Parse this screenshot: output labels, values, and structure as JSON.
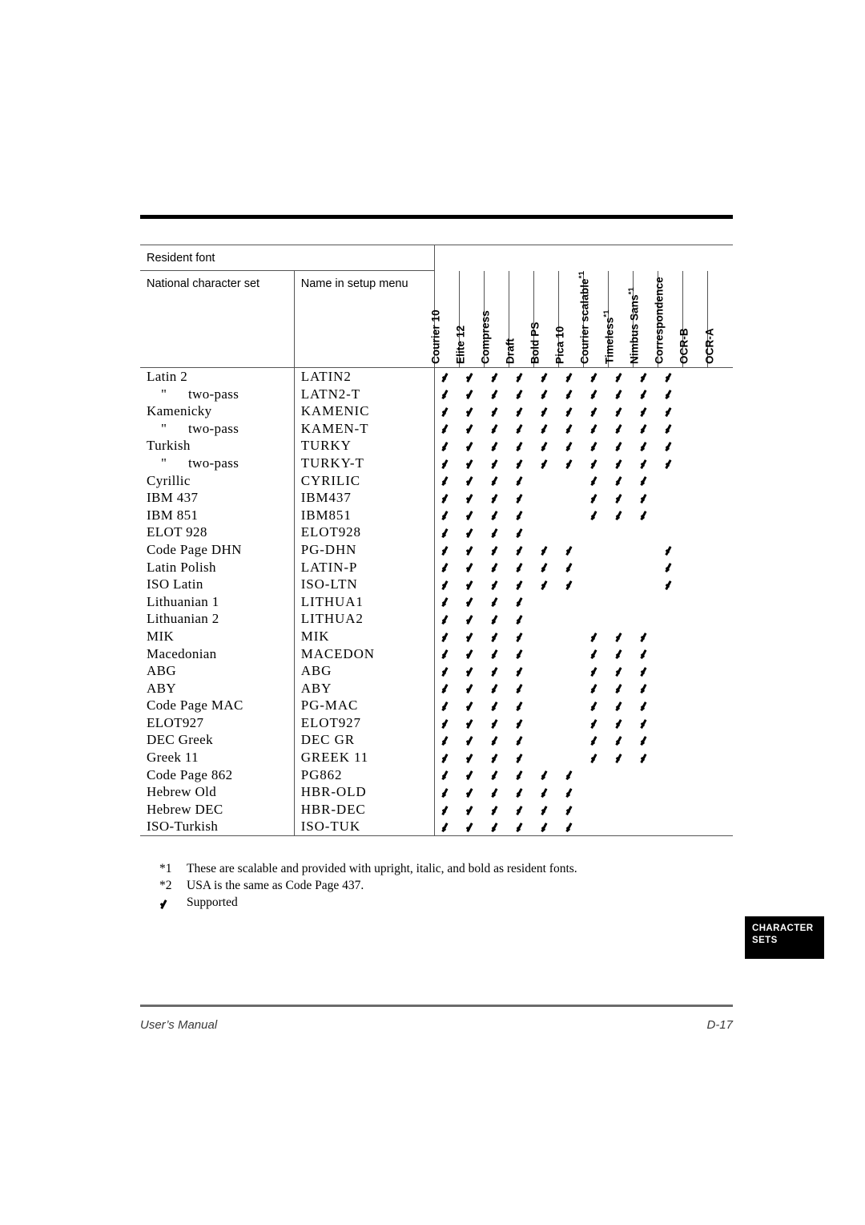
{
  "table": {
    "header": {
      "resident_font": "Resident font",
      "national_character_set": "National character set",
      "name_in_setup_menu": "Name in setup menu",
      "columns": [
        {
          "label": "Courier 10",
          "note": ""
        },
        {
          "label": "Elite 12",
          "note": ""
        },
        {
          "label": "Compress",
          "note": ""
        },
        {
          "label": "Draft",
          "note": ""
        },
        {
          "label": "Bold PS",
          "note": ""
        },
        {
          "label": "Pica 10",
          "note": ""
        },
        {
          "label": "Courier scalable",
          "note": "*1"
        },
        {
          "label": "Timeless",
          "note": "*1"
        },
        {
          "label": "Nimbus Sans",
          "note": "*1"
        },
        {
          "label": "Correspondence",
          "note": ""
        },
        {
          "label": "OCR-B",
          "note": ""
        },
        {
          "label": "OCR-A",
          "note": ""
        }
      ]
    },
    "rows": [
      {
        "set": "Latin 2",
        "quote": false,
        "menu": "LATIN2",
        "checks": [
          1,
          1,
          1,
          1,
          1,
          1,
          1,
          1,
          1,
          1,
          0,
          0
        ]
      },
      {
        "set": "two-pass",
        "quote": true,
        "menu": "LATN2-T",
        "checks": [
          1,
          1,
          1,
          1,
          1,
          1,
          1,
          1,
          1,
          1,
          0,
          0
        ]
      },
      {
        "set": "Kamenicky",
        "quote": false,
        "menu": "KAMENIC",
        "checks": [
          1,
          1,
          1,
          1,
          1,
          1,
          1,
          1,
          1,
          1,
          0,
          0
        ]
      },
      {
        "set": "two-pass",
        "quote": true,
        "menu": "KAMEN-T",
        "checks": [
          1,
          1,
          1,
          1,
          1,
          1,
          1,
          1,
          1,
          1,
          0,
          0
        ]
      },
      {
        "set": "Turkish",
        "quote": false,
        "menu": "TURKY",
        "checks": [
          1,
          1,
          1,
          1,
          1,
          1,
          1,
          1,
          1,
          1,
          0,
          0
        ]
      },
      {
        "set": "two-pass",
        "quote": true,
        "menu": "TURKY-T",
        "checks": [
          1,
          1,
          1,
          1,
          1,
          1,
          1,
          1,
          1,
          1,
          0,
          0
        ]
      },
      {
        "set": "Cyrillic",
        "quote": false,
        "menu": "CYRILIC",
        "checks": [
          1,
          1,
          1,
          1,
          0,
          0,
          1,
          1,
          1,
          0,
          0,
          0
        ]
      },
      {
        "set": "IBM 437",
        "quote": false,
        "menu": "IBM437",
        "checks": [
          1,
          1,
          1,
          1,
          0,
          0,
          1,
          1,
          1,
          0,
          0,
          0
        ]
      },
      {
        "set": "IBM 851",
        "quote": false,
        "menu": "IBM851",
        "checks": [
          1,
          1,
          1,
          1,
          0,
          0,
          1,
          1,
          1,
          0,
          0,
          0
        ]
      },
      {
        "set": "ELOT 928",
        "quote": false,
        "menu": "ELOT928",
        "checks": [
          1,
          1,
          1,
          1,
          0,
          0,
          0,
          0,
          0,
          0,
          0,
          0
        ]
      },
      {
        "set": "Code Page DHN",
        "quote": false,
        "menu": "PG-DHN",
        "checks": [
          1,
          1,
          1,
          1,
          1,
          1,
          0,
          0,
          0,
          1,
          0,
          0
        ]
      },
      {
        "set": "Latin Polish",
        "quote": false,
        "menu": "LATIN-P",
        "checks": [
          1,
          1,
          1,
          1,
          1,
          1,
          0,
          0,
          0,
          1,
          0,
          0
        ]
      },
      {
        "set": "ISO Latin",
        "quote": false,
        "menu": "ISO-LTN",
        "checks": [
          1,
          1,
          1,
          1,
          1,
          1,
          0,
          0,
          0,
          1,
          0,
          0
        ]
      },
      {
        "set": "Lithuanian 1",
        "quote": false,
        "menu": "LITHUA1",
        "checks": [
          1,
          1,
          1,
          1,
          0,
          0,
          0,
          0,
          0,
          0,
          0,
          0
        ]
      },
      {
        "set": "Lithuanian 2",
        "quote": false,
        "menu": "LITHUA2",
        "checks": [
          1,
          1,
          1,
          1,
          0,
          0,
          0,
          0,
          0,
          0,
          0,
          0
        ]
      },
      {
        "set": "MIK",
        "quote": false,
        "menu": "MIK",
        "checks": [
          1,
          1,
          1,
          1,
          0,
          0,
          1,
          1,
          1,
          0,
          0,
          0
        ]
      },
      {
        "set": "Macedonian",
        "quote": false,
        "menu": "MACEDON",
        "checks": [
          1,
          1,
          1,
          1,
          0,
          0,
          1,
          1,
          1,
          0,
          0,
          0
        ]
      },
      {
        "set": "ABG",
        "quote": false,
        "menu": "ABG",
        "checks": [
          1,
          1,
          1,
          1,
          0,
          0,
          1,
          1,
          1,
          0,
          0,
          0
        ]
      },
      {
        "set": "ABY",
        "quote": false,
        "menu": "ABY",
        "checks": [
          1,
          1,
          1,
          1,
          0,
          0,
          1,
          1,
          1,
          0,
          0,
          0
        ]
      },
      {
        "set": "Code Page MAC",
        "quote": false,
        "menu": "PG-MAC",
        "checks": [
          1,
          1,
          1,
          1,
          0,
          0,
          1,
          1,
          1,
          0,
          0,
          0
        ]
      },
      {
        "set": "ELOT927",
        "quote": false,
        "menu": "ELOT927",
        "checks": [
          1,
          1,
          1,
          1,
          0,
          0,
          1,
          1,
          1,
          0,
          0,
          0
        ]
      },
      {
        "set": "DEC Greek",
        "quote": false,
        "menu": "DEC GR",
        "checks": [
          1,
          1,
          1,
          1,
          0,
          0,
          1,
          1,
          1,
          0,
          0,
          0
        ]
      },
      {
        "set": "Greek 11",
        "quote": false,
        "menu": "GREEK 11",
        "checks": [
          1,
          1,
          1,
          1,
          0,
          0,
          1,
          1,
          1,
          0,
          0,
          0
        ]
      },
      {
        "set": "Code Page 862",
        "quote": false,
        "menu": "PG862",
        "checks": [
          1,
          1,
          1,
          1,
          1,
          1,
          0,
          0,
          0,
          0,
          0,
          0
        ]
      },
      {
        "set": "Hebrew Old",
        "quote": false,
        "menu": "HBR-OLD",
        "checks": [
          1,
          1,
          1,
          1,
          1,
          1,
          0,
          0,
          0,
          0,
          0,
          0
        ]
      },
      {
        "set": "Hebrew DEC",
        "quote": false,
        "menu": "HBR-DEC",
        "checks": [
          1,
          1,
          1,
          1,
          1,
          1,
          0,
          0,
          0,
          0,
          0,
          0
        ]
      },
      {
        "set": "ISO-Turkish",
        "quote": false,
        "menu": "ISO-TUK",
        "checks": [
          1,
          1,
          1,
          1,
          1,
          1,
          0,
          0,
          0,
          0,
          0,
          0
        ]
      }
    ],
    "quote_mark": "\""
  },
  "notes": [
    {
      "mark": "*1",
      "text": "These are scalable and provided with upright, italic, and bold as resident fonts."
    },
    {
      "mark": "*2",
      "text": "USA is the same as Code Page 437."
    },
    {
      "mark": "check",
      "text": "Supported"
    }
  ],
  "side_tab": {
    "line1": "CHARACTER",
    "line2": "SETS"
  },
  "footer": {
    "left": "User’s Manual",
    "right": "D-17"
  },
  "colors": {
    "rule": "#555555",
    "thick_rule": "#000000",
    "tab_background": "#000000",
    "tab_text": "#ffffff",
    "footer_text": "#3a3a3a"
  }
}
